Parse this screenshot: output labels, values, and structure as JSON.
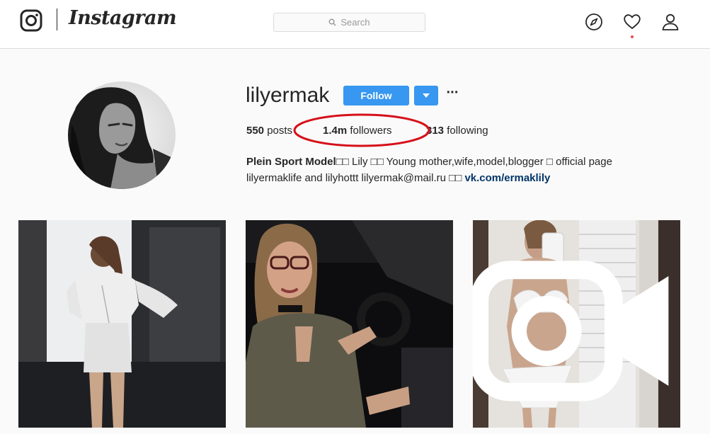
{
  "app": {
    "wordmark": "Instagram"
  },
  "nav": {
    "search_placeholder": "Search",
    "icons": [
      "instagram-logo-icon",
      "search-icon",
      "compass-icon",
      "heart-icon",
      "person-icon"
    ],
    "activity_dot_color": "#ed4956"
  },
  "profile": {
    "username": "lilyermak",
    "follow_label": "Follow",
    "stats": {
      "posts_count": "550",
      "posts_label": "posts",
      "followers_count": "1.4m",
      "followers_label": "followers",
      "following_count": "313",
      "following_label": "following"
    },
    "bio": {
      "name": "Plein Sport Model",
      "name_emoji": "□□",
      "text_1": " Lily □□ Young mother,wife,model,blogger □ official page",
      "text_2": "lilyermaklife and lilyhottt lilyermak@mail.ru □□ ",
      "link": "vk.com/ermaklily"
    }
  },
  "annotation": {
    "ellipse_color": "#d6101a"
  },
  "colors": {
    "accent": "#3897f0",
    "link": "#003569"
  },
  "posts": [
    {
      "description": "photo-white-lace-up-outfit"
    },
    {
      "description": "photo-in-car-with-glasses"
    },
    {
      "description": "video-mirror-selfie",
      "badge": "video-icon"
    }
  ]
}
